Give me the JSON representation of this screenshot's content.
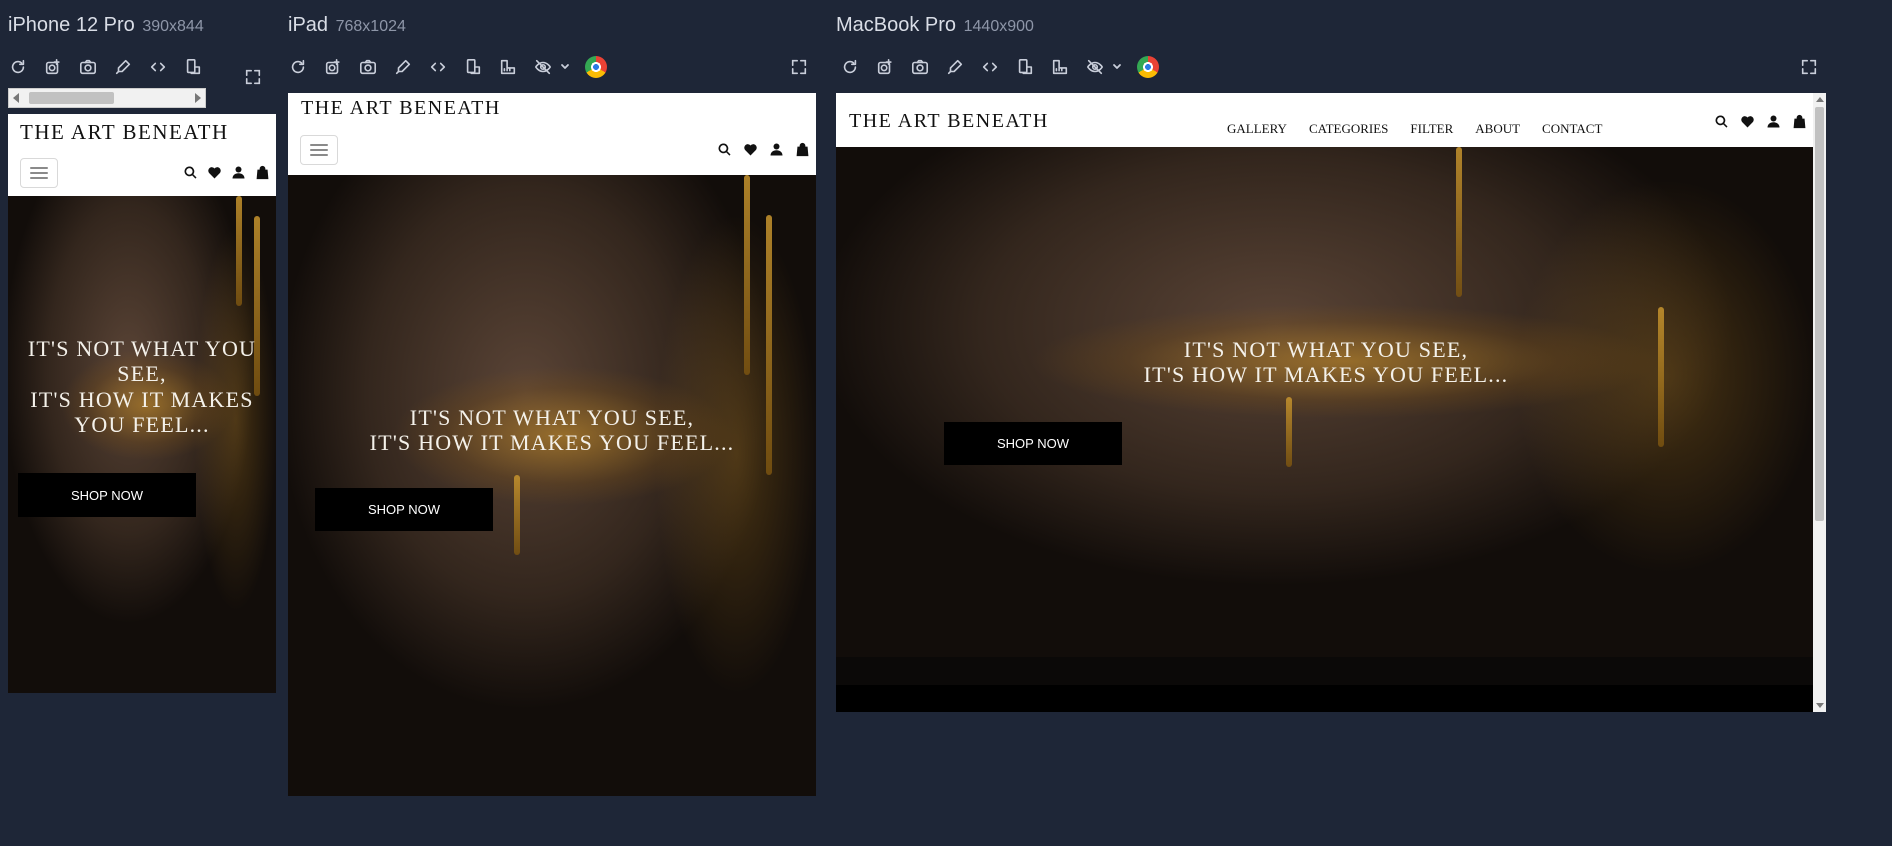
{
  "devices": [
    {
      "name": "iPhone 12 Pro",
      "size": "390x844"
    },
    {
      "name": "iPad",
      "size": "768x1024"
    },
    {
      "name": "MacBook Pro",
      "size": "1440x900"
    }
  ],
  "site": {
    "brand": "THE ART BENEATH",
    "nav": [
      "GALLERY",
      "CATEGORIES",
      "FILTER",
      "ABOUT",
      "CONTACT"
    ],
    "hero_line1": "IT'S NOT WHAT YOU SEE,",
    "hero_line2": "IT'S HOW IT MAKES YOU FEEL...",
    "cta": "SHOP NOW"
  },
  "toolbar_icons": [
    "reload-icon",
    "screenshot-target-icon",
    "camera-icon",
    "eyedropper-icon",
    "code-icon",
    "rotate-device-icon",
    "ruler-icon",
    "hide-icon",
    "chevron-down-icon",
    "browser-logo-icon",
    "fullscreen-icon"
  ],
  "colors": {
    "canvas": "#1e2637",
    "header": "#ffffff",
    "button": "#000000",
    "gold": "#c8952e"
  }
}
